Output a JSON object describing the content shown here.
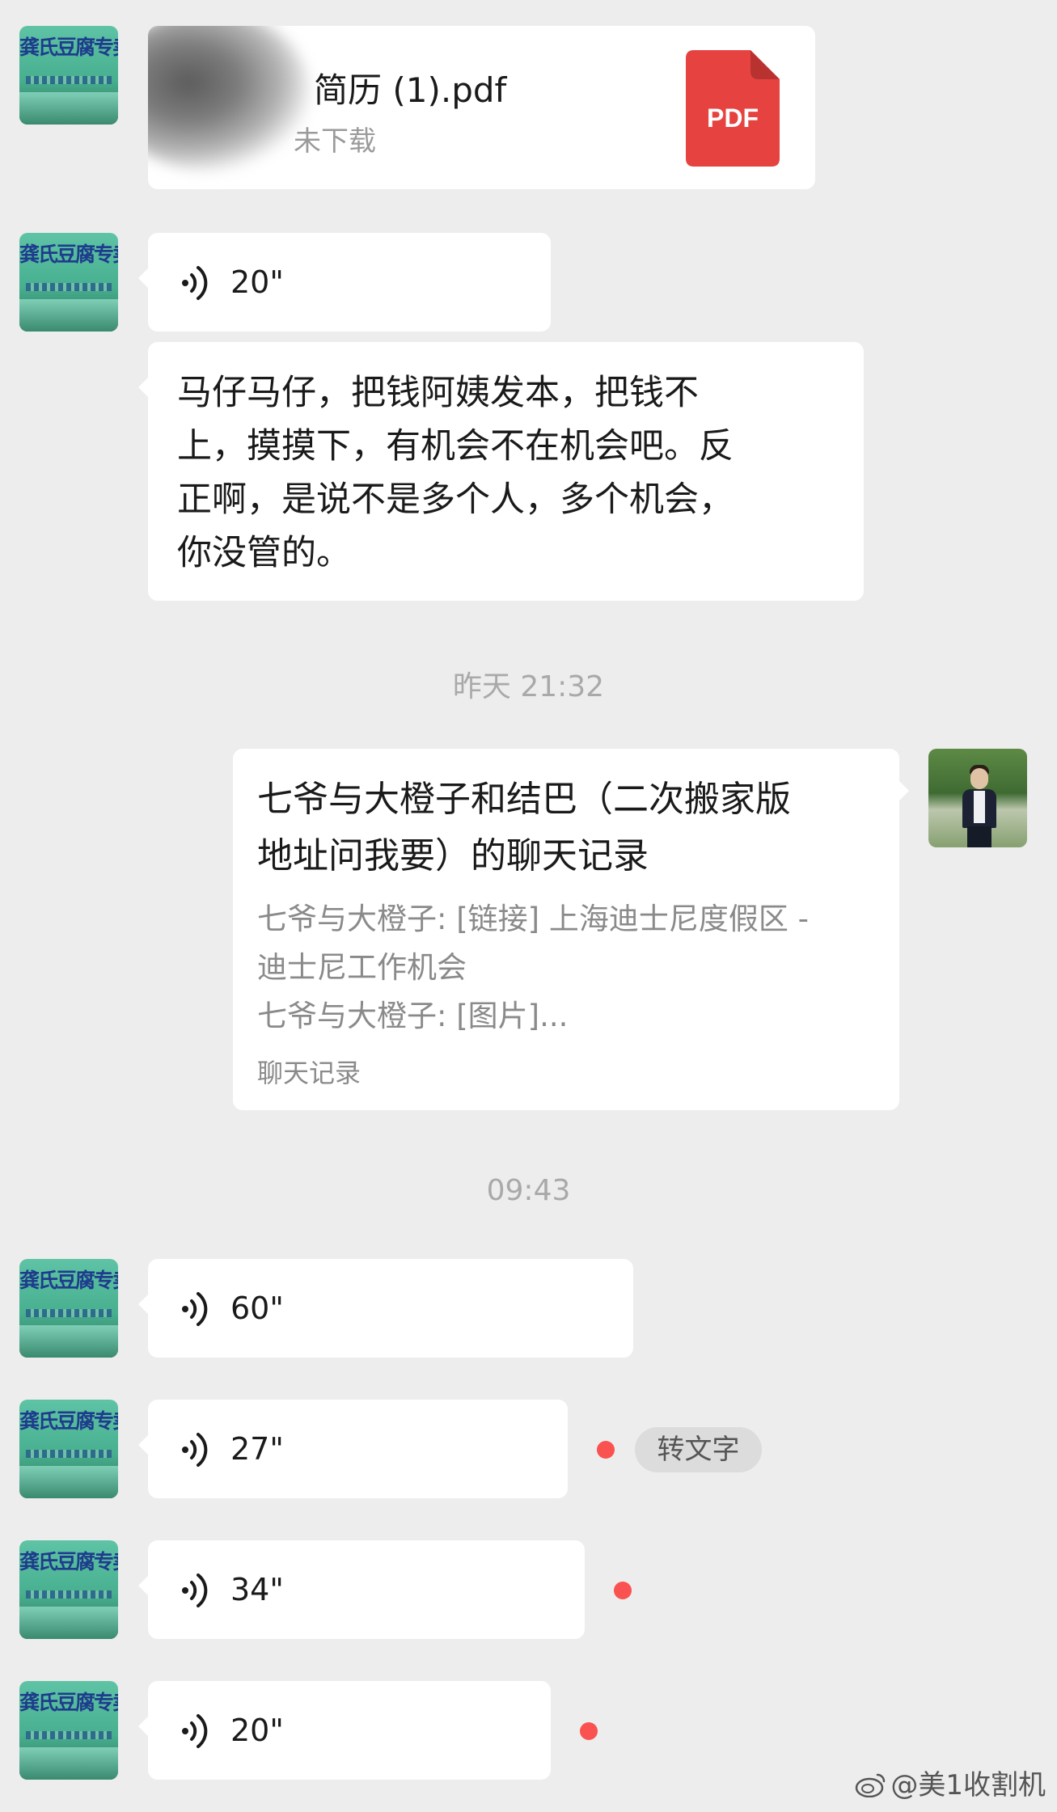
{
  "file_message": {
    "file_name": "简历 (1).pdf",
    "status": "未下载",
    "file_type_label": "PDF"
  },
  "voice_top": {
    "duration": "20\""
  },
  "text_message": {
    "lines": [
      "马仔马仔，把钱阿姨发本，把钱不",
      "上，摸摸下，有机会不在机会吧。反",
      "正啊，是说不是多个人，多个机会，",
      "你没管的。"
    ]
  },
  "time_divider_1": "昨天 21:32",
  "chat_record": {
    "title_lines": [
      "七爷与大橙子和结巴（二次搬家版",
      "地址问我要）的聊天记录"
    ],
    "preview_lines": [
      "七爷与大橙子: [链接] 上海迪士尼度假区 -",
      "迪士尼工作机会",
      "七爷与大橙子: [图片]..."
    ],
    "footer": "聊天记录"
  },
  "time_divider_2": "09:43",
  "voice_messages": [
    {
      "duration": "60\"",
      "unread": false
    },
    {
      "duration": "27\"",
      "unread": true,
      "action_label": "转文字"
    },
    {
      "duration": "34\"",
      "unread": true
    },
    {
      "duration": "20\"",
      "unread": true
    }
  ],
  "avatar_shop_sign": "龚氏豆腐专卖店",
  "watermark": "@美1收割机",
  "colors": {
    "background": "#ededed",
    "bubble": "#ffffff",
    "unread_dot": "#fa5151",
    "pdf_icon": "#e64340"
  }
}
